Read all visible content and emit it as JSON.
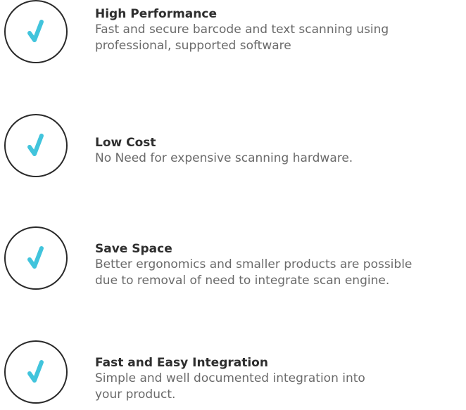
{
  "theme": {
    "check_color": "#41c4dc",
    "circle_stroke": "#2a2a2a",
    "title_color": "#2e2e2e",
    "text_color": "#6a6a6a"
  },
  "features": [
    {
      "icon": "checkmark-circle-icon",
      "title": "High Performance",
      "description_lines": [
        "Fast and secure barcode and text scanning using",
        "professional, supported software"
      ]
    },
    {
      "icon": "checkmark-circle-icon",
      "title": "Low Cost",
      "description_lines": [
        "No Need for expensive scanning hardware."
      ]
    },
    {
      "icon": "checkmark-circle-icon",
      "title": "Save Space",
      "description_lines": [
        "Better ergonomics and smaller products are possible",
        "due to removal of need to integrate scan engine."
      ]
    },
    {
      "icon": "checkmark-circle-icon",
      "title": "Fast and Easy Integration",
      "description_lines": [
        "Simple and well documented integration into",
        "your product."
      ]
    }
  ]
}
